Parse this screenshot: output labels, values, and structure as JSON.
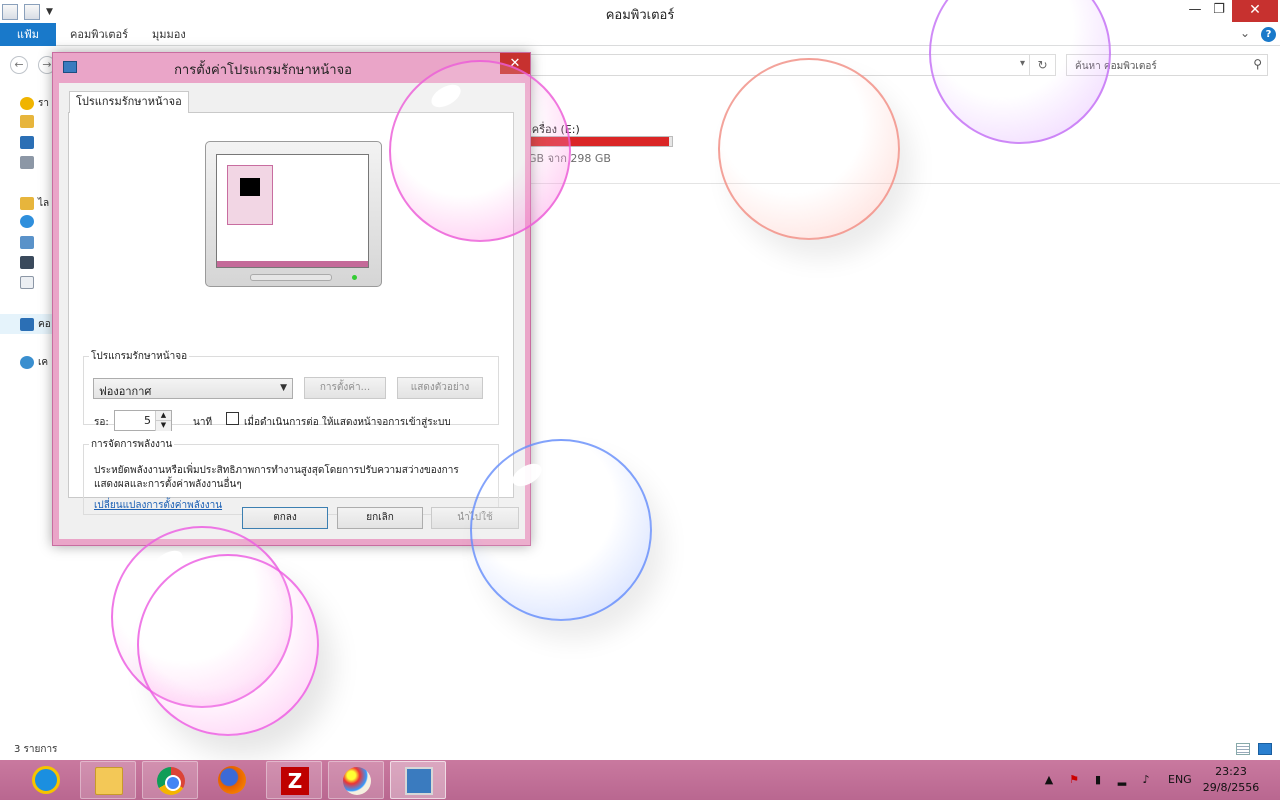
{
  "explorer": {
    "title": "คอมพิวเตอร์",
    "ribbon": {
      "file_tab": "แฟ้ม",
      "tab_computer": "คอมพิวเตอร์",
      "tab_view": "มุมมอง"
    },
    "search_placeholder": "ค้นหา คอมพิวเตอร์",
    "drive": {
      "name": "เครื่อง (E:)",
      "size_text": "GB จาก 298 GB",
      "used_fraction": 0.98
    },
    "nav_partial": {
      "favorites": "รา",
      "libraries": "ไล",
      "computer": "คอ",
      "network": "เค"
    },
    "status": {
      "item_count": "3 รายการ"
    }
  },
  "dialog": {
    "title": "การตั้งค่าโปรแกรมรักษาหน้าจอ",
    "tab_label": "โปรแกรมรักษาหน้าจอ",
    "screensaver_group": {
      "legend": "โปรแกรมรักษาหน้าจอ",
      "selected": "ฟองอากาศ",
      "settings_button": "การตั้งค่า...",
      "preview_button": "แสดงตัวอย่าง",
      "wait_label": "รอ:",
      "wait_value": "5",
      "minutes_label": "นาที",
      "resume_checkbox_label": "เมื่อดำเนินการต่อ ให้แสดงหน้าจอการเข้าสู่ระบบ",
      "resume_checked": false
    },
    "power_group": {
      "legend": "การจัดการพลังงาน",
      "description": "ประหยัดพลังงานหรือเพิ่มประสิทธิภาพการทำงานสูงสุดโดยการปรับความสว่างของการแสดงผลและการตั้งค่าพลังงานอื่นๆ",
      "link": "เปลี่ยนแปลงการตั้งค่าพลังงาน"
    },
    "buttons": {
      "ok": "ตกลง",
      "cancel": "ยกเลิก",
      "apply": "นำไปใช้"
    }
  },
  "taskbar": {
    "apps": [
      {
        "name": "internet-explorer-icon"
      },
      {
        "name": "file-explorer-icon"
      },
      {
        "name": "chrome-icon"
      },
      {
        "name": "firefox-icon"
      },
      {
        "name": "filezilla-icon",
        "glyph": "Z"
      },
      {
        "name": "paint-icon"
      },
      {
        "name": "screensaver-settings-icon"
      }
    ],
    "tray": {
      "language": "ENG",
      "time": "23:23",
      "date": "29/8/2556"
    }
  },
  "colors": {
    "accent": "#1979ca",
    "dialog_frame": "#eaa5c8",
    "taskbar": "#c46a99",
    "close_red": "#c7312f",
    "drive_bar": "#da2626"
  }
}
